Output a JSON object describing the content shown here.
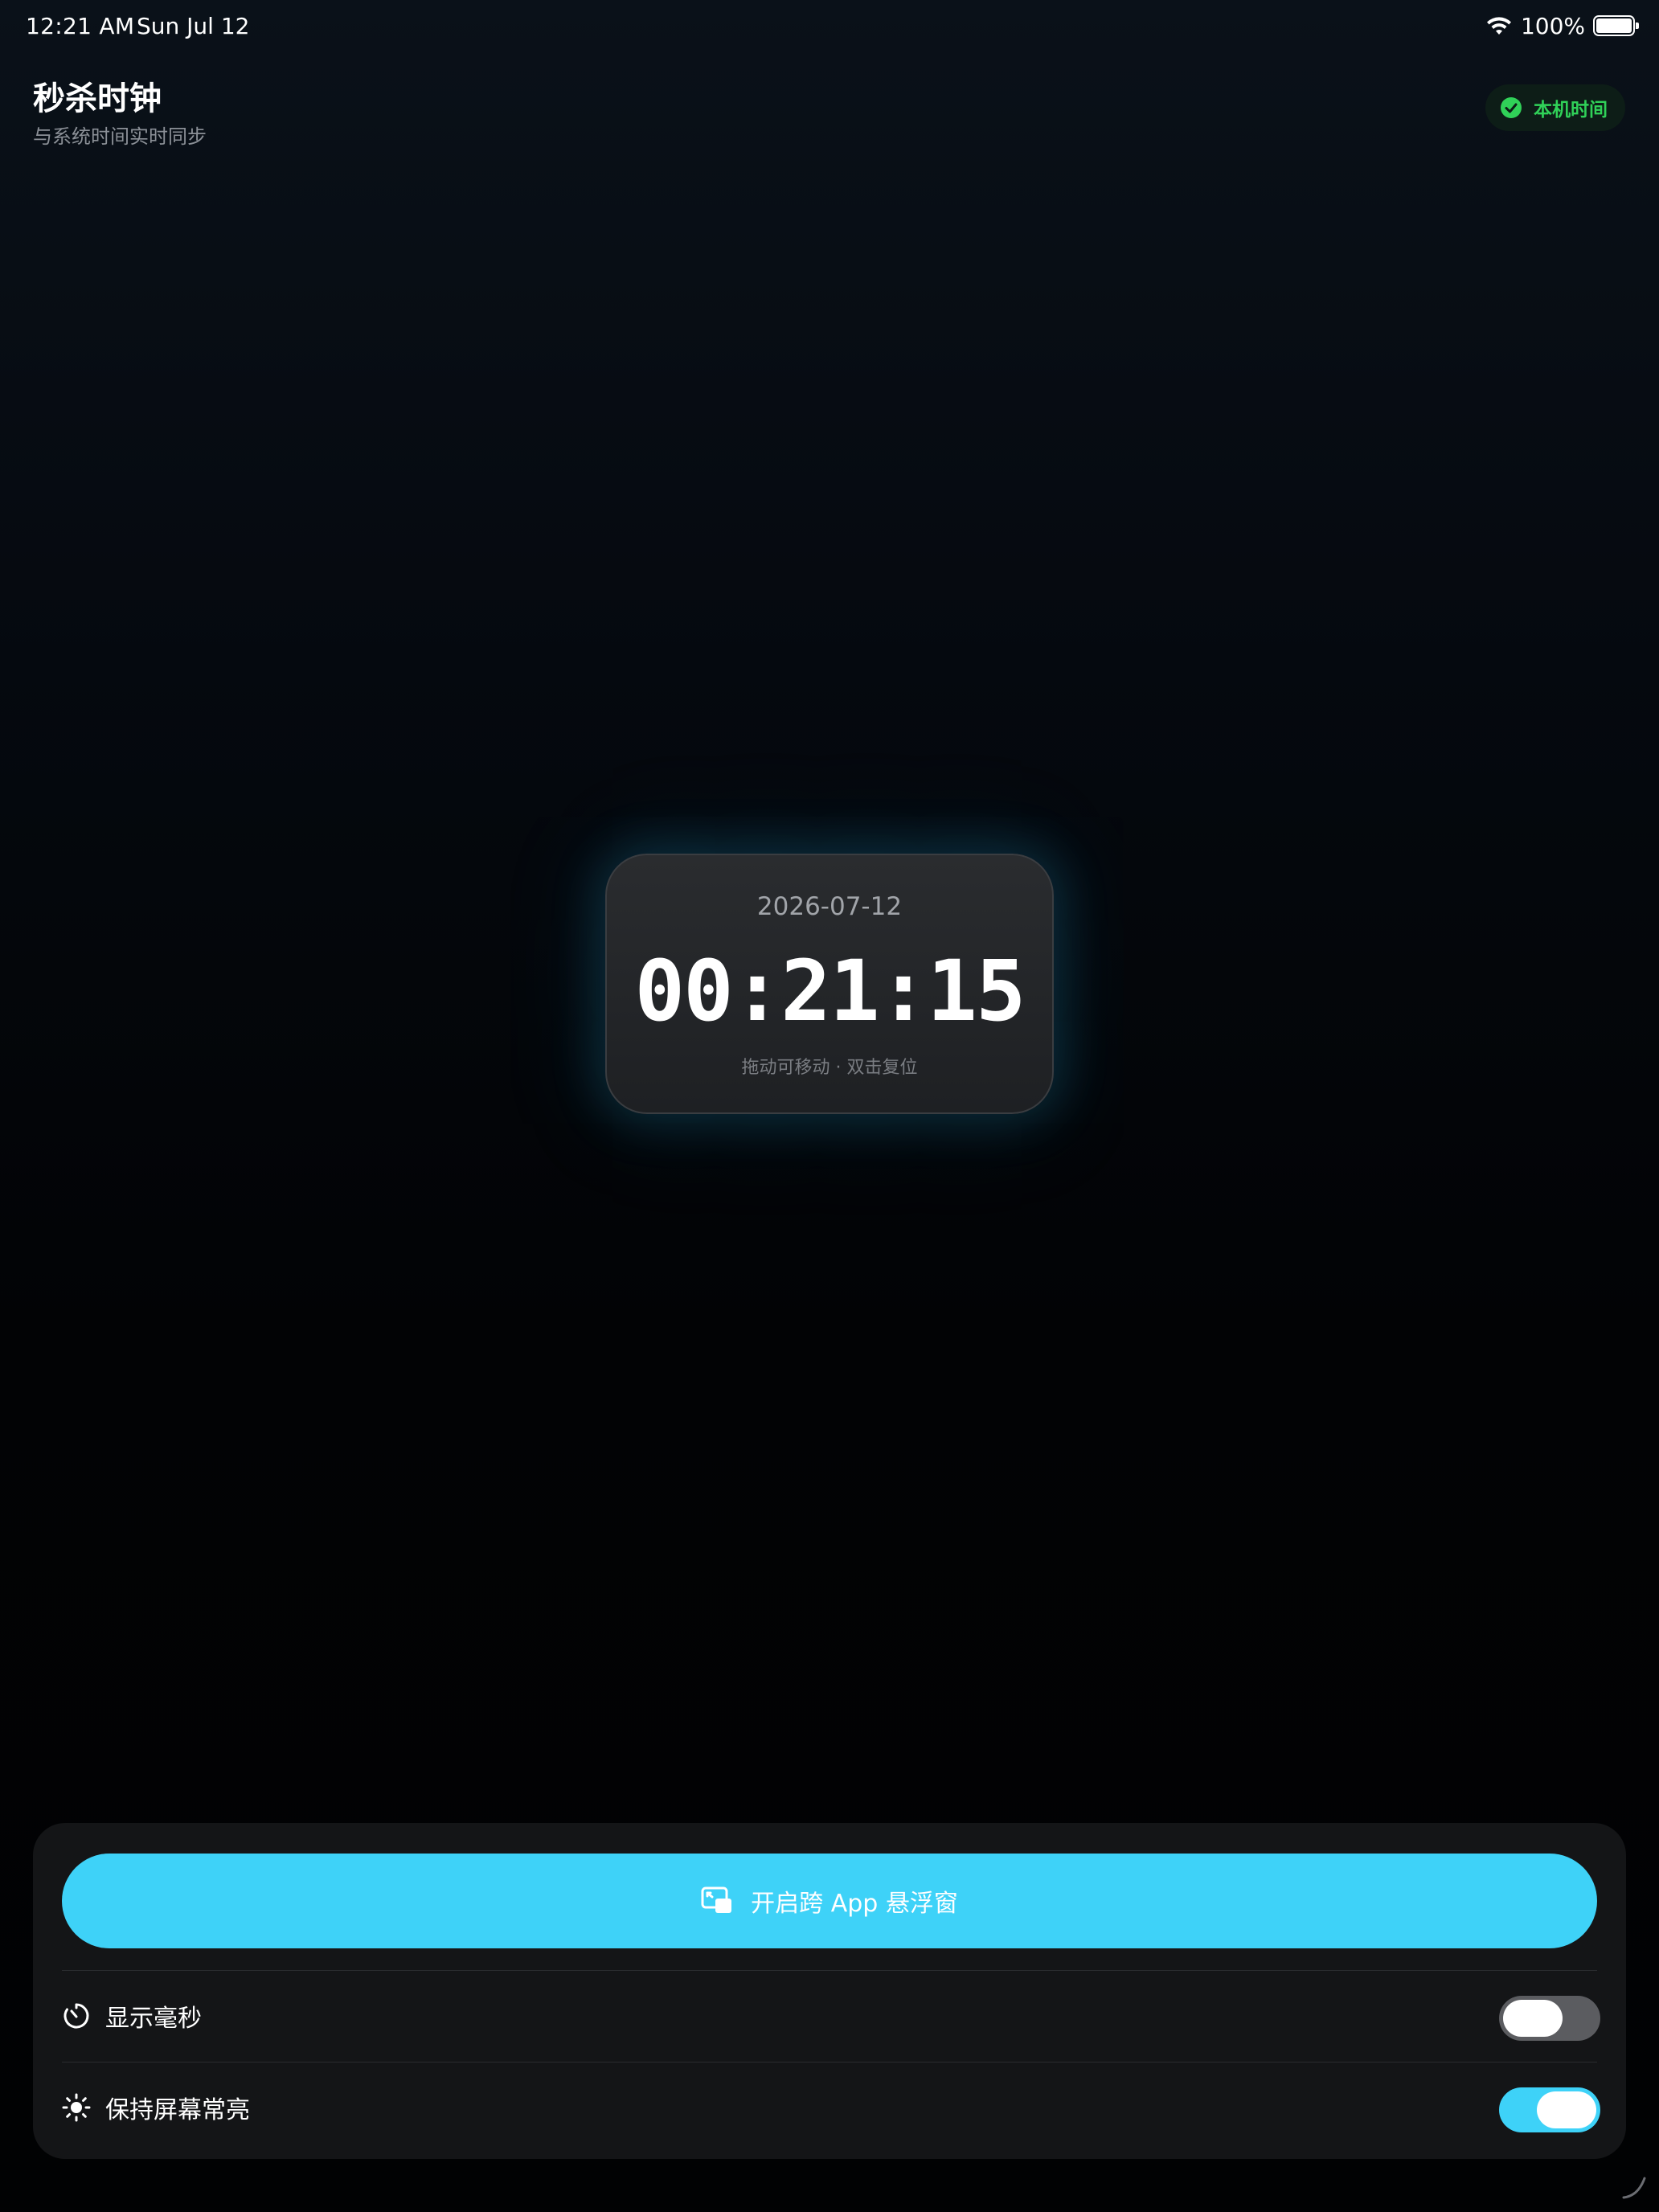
{
  "status_bar": {
    "time": "12:21 AM",
    "date": "Sun Jul 12",
    "battery": "100%"
  },
  "header": {
    "title": "秒杀时钟",
    "subtitle": "与系统时间实时同步",
    "badge": "本机时间"
  },
  "clock": {
    "date": "2026-07-12",
    "time": "00:21:15",
    "hint": "拖动可移动 · 双击复位"
  },
  "controls": {
    "float_button": "开启跨 App 悬浮窗",
    "settings": [
      {
        "label": "显示毫秒",
        "enabled": false
      },
      {
        "label": "保持屏幕常亮",
        "enabled": true
      }
    ]
  },
  "colors": {
    "accent": "#3ed2f8",
    "success": "#30d158",
    "toggle_off": "#5b5c60",
    "panel": "#141517"
  },
  "icons": [
    "wifi-icon",
    "battery-icon",
    "check-circle-icon",
    "picture-in-picture-icon",
    "timer-icon",
    "sun-icon"
  ]
}
